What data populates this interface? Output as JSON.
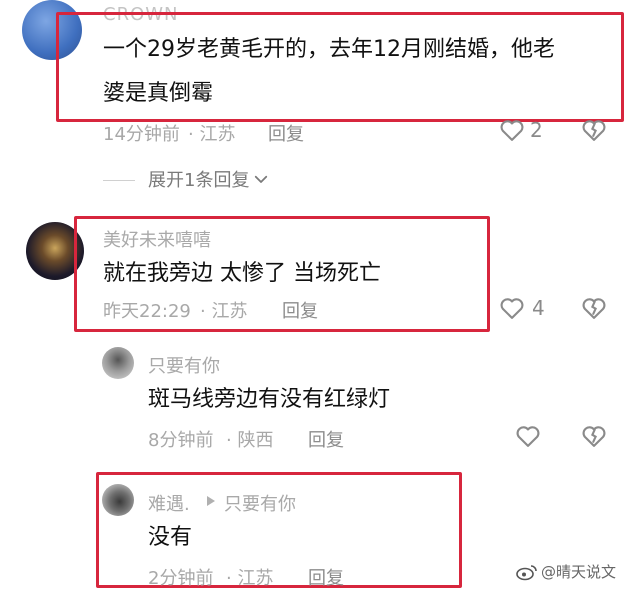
{
  "comments": [
    {
      "author": "CROWN",
      "text_line1": "一个29岁老黄毛开的，去年12月刚结婚，他老",
      "text_line2": "婆是真倒霉",
      "time": "14分钟前",
      "location": "· 江苏",
      "reply_label": "回复",
      "likes": "2",
      "expand_label": "展开1条回复"
    },
    {
      "author": "美好未来嘻嘻",
      "text": "就在我旁边  太惨了  当场死亡",
      "time": "昨天22:29",
      "location": "· 江苏",
      "reply_label": "回复",
      "likes": "4"
    }
  ],
  "replies": [
    {
      "author": "只要有你",
      "text": "斑马线旁边有没有红绿灯",
      "time": "8分钟前",
      "location": "· 陕西",
      "reply_label": "回复"
    },
    {
      "author": "难遇.",
      "reply_to": "只要有你",
      "text": "没有",
      "time": "2分钟前",
      "location": "· 江苏",
      "reply_label": "回复"
    }
  ],
  "watermark": "@晴天说文",
  "colors": {
    "highlight": "#d7263d",
    "meta": "#a8a8a8"
  },
  "icons": [
    "heart-icon",
    "broken-heart-icon",
    "chevron-down-icon",
    "play-triangle-icon"
  ]
}
